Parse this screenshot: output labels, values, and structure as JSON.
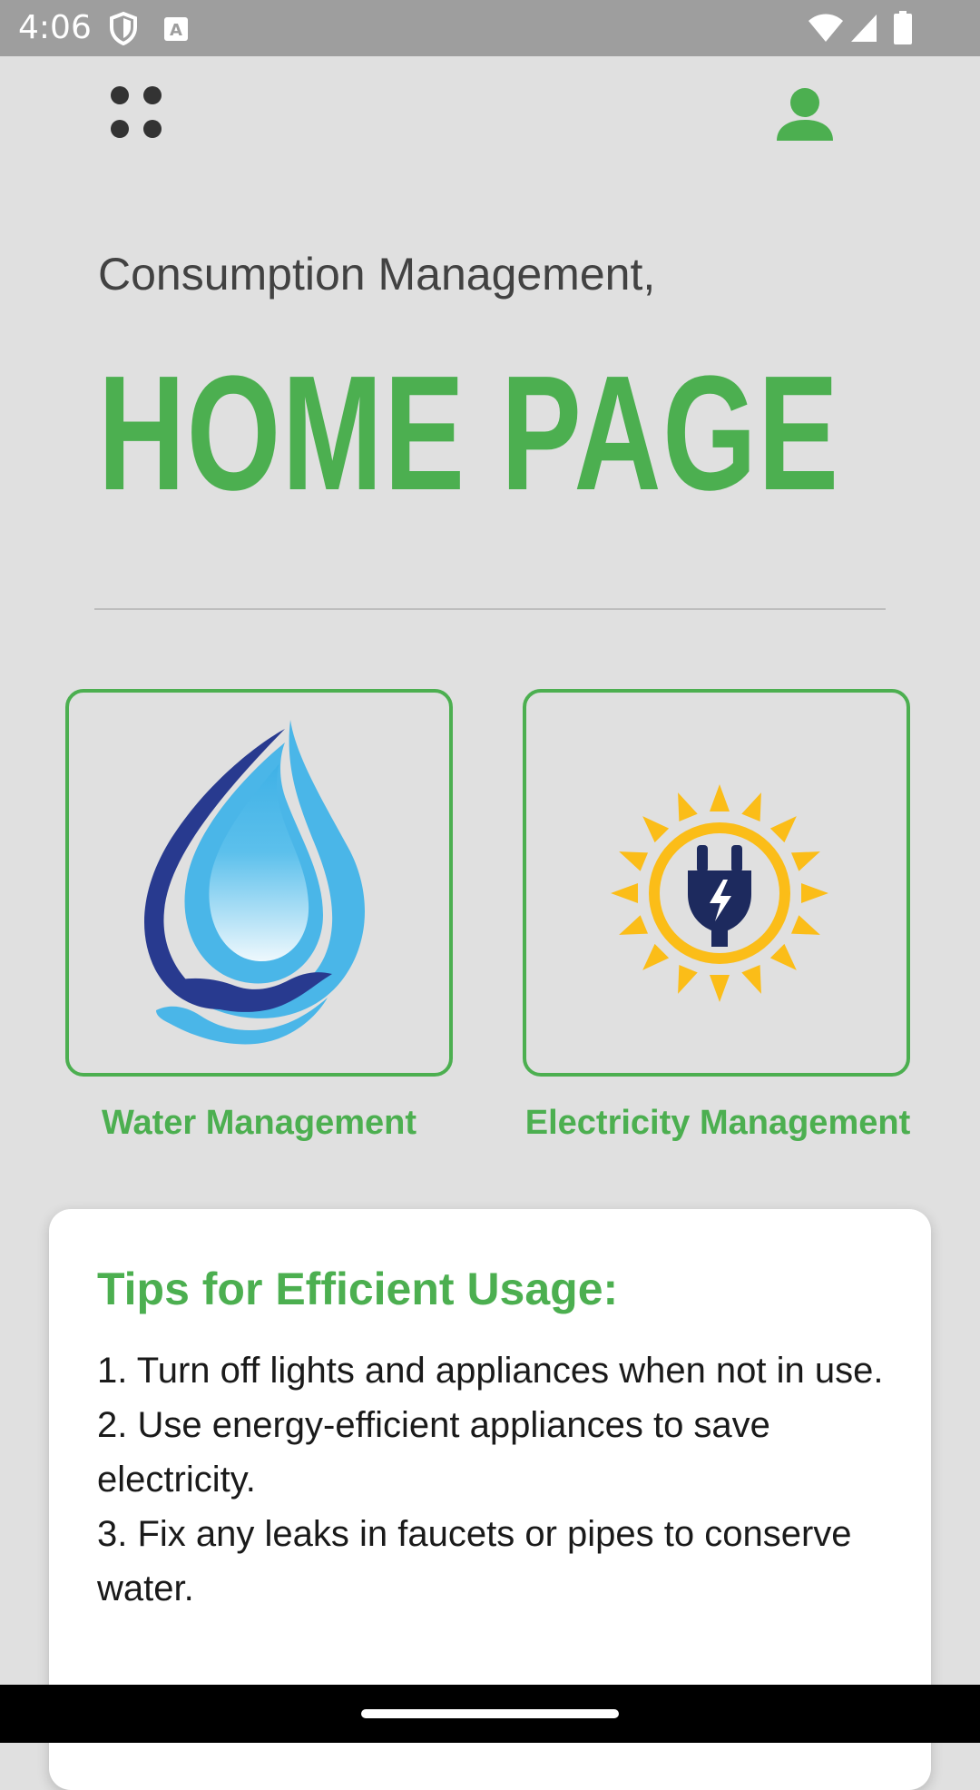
{
  "status_bar": {
    "time": "4:06",
    "left_icons": [
      "shield-icon",
      "font-a-icon"
    ],
    "right_icons": [
      "wifi-icon",
      "signal-icon",
      "battery-icon"
    ]
  },
  "app_bar": {
    "menu_icon": "grid-dots-icon",
    "profile_icon": "person-icon"
  },
  "header": {
    "subtitle": "Consumption Management,",
    "title": "HOME PAGE"
  },
  "cards": [
    {
      "label": "Water Management",
      "icon": "water-drop-hand-icon"
    },
    {
      "label": "Electricity Management",
      "icon": "sun-plug-icon"
    }
  ],
  "tips": {
    "title": "Tips for Efficient Usage:",
    "items": [
      "1. Turn off lights and appliances when not in use.",
      "2. Use energy-efficient appliances to save electricity.",
      "3. Fix any leaks in faucets or pipes to conserve water."
    ]
  },
  "colors": {
    "accent": "#4caf50",
    "background": "#e0e0e0",
    "status_bar": "#9e9e9e",
    "sun_yellow": "#fbbd18",
    "plug_navy": "#1d2a5e",
    "water_blue": "#4ab6e8",
    "water_navy": "#283a8f"
  }
}
